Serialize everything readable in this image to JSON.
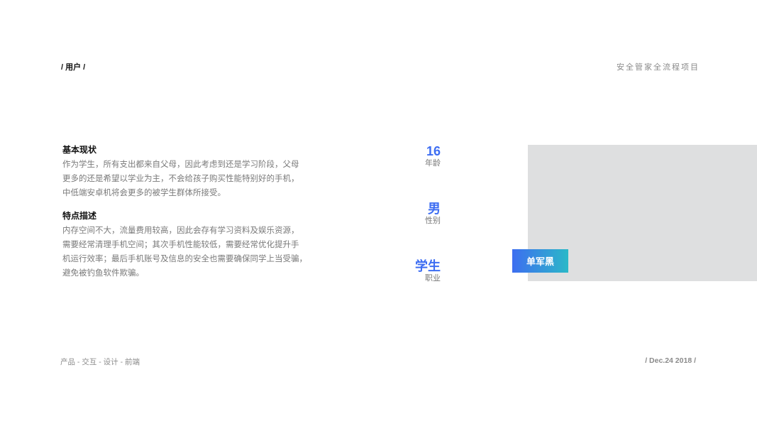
{
  "header": {
    "breadcrumb": "/ 用户 /",
    "project_title": "安全管家全流程项目"
  },
  "sections": [
    {
      "title": "基本现状",
      "lines": [
        "作为学生，所有支出都来自父母，因此考虑到还是学习阶段，父母",
        "更多的还是希望以学业为主，不会给孩子购买性能特别好的手机，",
        "中低端安卓机将会更多的被学生群体所接受。"
      ]
    },
    {
      "title": "特点描述",
      "lines": [
        "内存空间不大，流量费用较高，因此会存有学习资料及娱乐资源，",
        "需要经常清理手机空间；其次手机性能较低，需要经常优化提升手",
        "机运行效率；最后手机账号及信息的安全也需要确保同学上当受骗，",
        "避免被钓鱼软件欺骗。"
      ]
    }
  ],
  "stats": {
    "age": {
      "value": "16",
      "label": "年龄"
    },
    "gender": {
      "value": "男",
      "label": "性别"
    },
    "job": {
      "value": "学生",
      "label": "职业"
    }
  },
  "persona": {
    "name": "单军黑"
  },
  "footer": {
    "left": "产品 - 交互 - 设计 - 前端",
    "right": "/ Dec.24 2018 /"
  },
  "colors": {
    "accent": "#3d6df2",
    "gradient_start": "#3d6ef0",
    "gradient_end": "#2bb8c8",
    "placeholder": "#dedfe0"
  }
}
